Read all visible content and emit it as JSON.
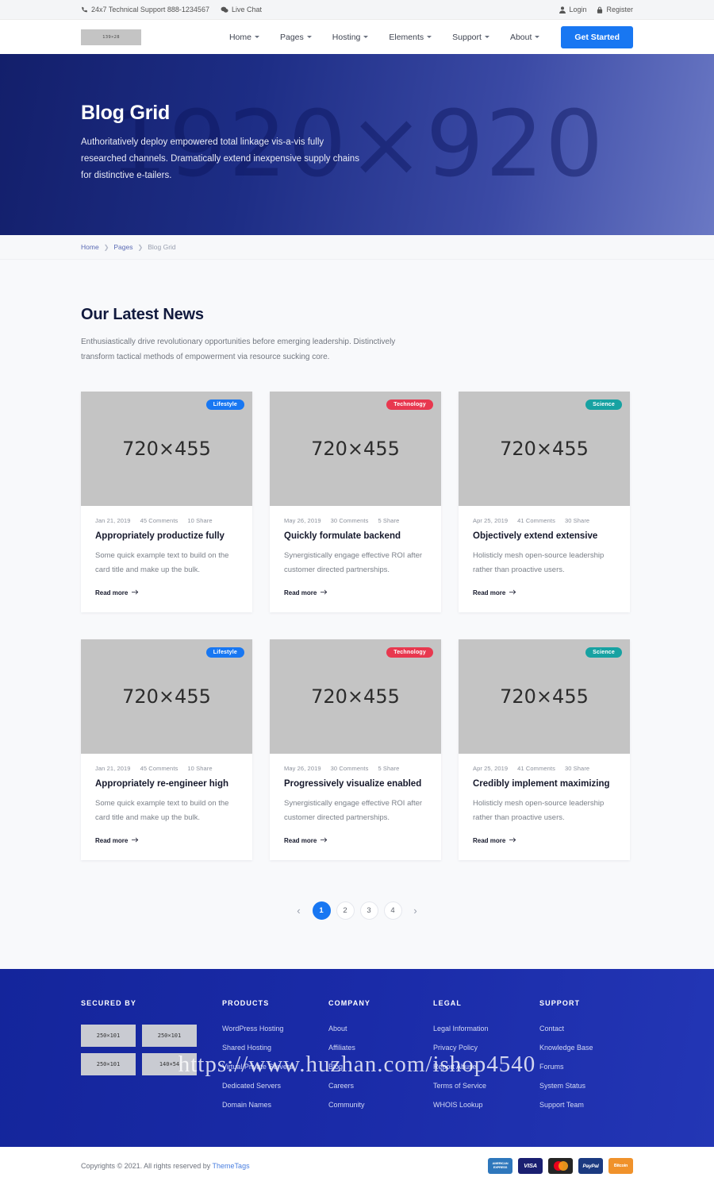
{
  "topbar": {
    "support_text": "24x7 Technical Support 888-1234567",
    "live_chat": "Live Chat",
    "login": "Login",
    "register": "Register"
  },
  "header": {
    "logo_placeholder": "139×28",
    "nav": [
      {
        "label": "Home",
        "has_caret": true
      },
      {
        "label": "Pages",
        "has_caret": true
      },
      {
        "label": "Hosting",
        "has_caret": true
      },
      {
        "label": "Elements",
        "has_caret": true
      },
      {
        "label": "Support",
        "has_caret": true
      },
      {
        "label": "About",
        "has_caret": true
      }
    ],
    "cta_label": "Get Started"
  },
  "hero": {
    "watermark": "1920×920",
    "title": "Blog Grid",
    "description": "Authoritatively deploy empowered total linkage vis-a-vis fully researched channels. Dramatically extend inexpensive supply chains for distinctive e-tailers."
  },
  "breadcrumb": {
    "home": "Home",
    "pages": "Pages",
    "current": "Blog Grid",
    "separator": "❯"
  },
  "main": {
    "section_title": "Our Latest News",
    "section_desc": "Enthusiastically drive revolutionary opportunities before emerging leadership. Distinctively transform tactical methods of empowerment via resource sucking core.",
    "thumb_placeholder": "720×455",
    "read_more": "Read more",
    "cards": [
      {
        "badge": "Lifestyle",
        "badge_color": "#1877f2",
        "date": "Jan 21, 2019",
        "comments": "45 Comments",
        "shares": "10 Share",
        "title": "Appropriately productize fully",
        "text": "Some quick example text to build on the card title and make up the bulk."
      },
      {
        "badge": "Technology",
        "badge_color": "#e8384f",
        "date": "May 26, 2019",
        "comments": "30 Comments",
        "shares": "5 Share",
        "title": "Quickly formulate backend",
        "text": "Synergistically engage effective ROI after customer directed partnerships."
      },
      {
        "badge": "Science",
        "badge_color": "#17a2a2",
        "date": "Apr 25, 2019",
        "comments": "41 Comments",
        "shares": "30 Share",
        "title": "Objectively extend extensive",
        "text": "Holisticly mesh open-source leadership rather than proactive users."
      },
      {
        "badge": "Lifestyle",
        "badge_color": "#1877f2",
        "date": "Jan 21, 2019",
        "comments": "45 Comments",
        "shares": "10 Share",
        "title": "Appropriately re-engineer high",
        "text": "Some quick example text to build on the card title and make up the bulk."
      },
      {
        "badge": "Technology",
        "badge_color": "#e8384f",
        "date": "May 26, 2019",
        "comments": "30 Comments",
        "shares": "5 Share",
        "title": "Progressively visualize enabled",
        "text": "Synergistically engage effective ROI after customer directed partnerships."
      },
      {
        "badge": "Science",
        "badge_color": "#17a2a2",
        "date": "Apr 25, 2019",
        "comments": "41 Comments",
        "shares": "30 Share",
        "title": "Credibly implement maximizing",
        "text": "Holisticly mesh open-source leadership rather than proactive users."
      }
    ],
    "pagination": {
      "prev": "‹",
      "next": "›",
      "pages": [
        "1",
        "2",
        "3",
        "4"
      ],
      "active": "1"
    }
  },
  "footer": {
    "secured": {
      "heading": "SECURED BY",
      "badges": [
        "250×101",
        "250×101",
        "250×101",
        "140×54"
      ]
    },
    "columns": [
      {
        "heading": "PRODUCTS",
        "links": [
          "WordPress Hosting",
          "Shared Hosting",
          "Virtual Private Servers",
          "Dedicated Servers",
          "Domain Names"
        ]
      },
      {
        "heading": "COMPANY",
        "links": [
          "About",
          "Affiliates",
          "Blog",
          "Careers",
          "Community"
        ]
      },
      {
        "heading": "LEGAL",
        "links": [
          "Legal Information",
          "Privacy Policy",
          "Report Abuse",
          "Terms of Service",
          "WHOIS Lookup"
        ]
      },
      {
        "heading": "SUPPORT",
        "links": [
          "Contact",
          "Knowledge Base",
          "Forums",
          "System Status",
          "Support Team"
        ]
      }
    ],
    "watermark": "https://www.huzhan.com/ishop4540",
    "copyright_prefix": "Copyrights © 2021. All rights reserved by ",
    "copyright_brand": "ThemeTags",
    "payments": [
      {
        "name": "American Express",
        "label": "AMERICAN\nEXPRESS",
        "color": "#2e77bc"
      },
      {
        "name": "VISA",
        "label": "VISA",
        "color": "#1a1f71"
      },
      {
        "name": "MasterCard",
        "label": "MasterCard",
        "color": "#252525"
      },
      {
        "name": "PayPal",
        "label": "PayPal",
        "color": "#1b3a80"
      },
      {
        "name": "Bitcoin",
        "label": "Bitcoin",
        "color": "#f0922b"
      }
    ]
  }
}
